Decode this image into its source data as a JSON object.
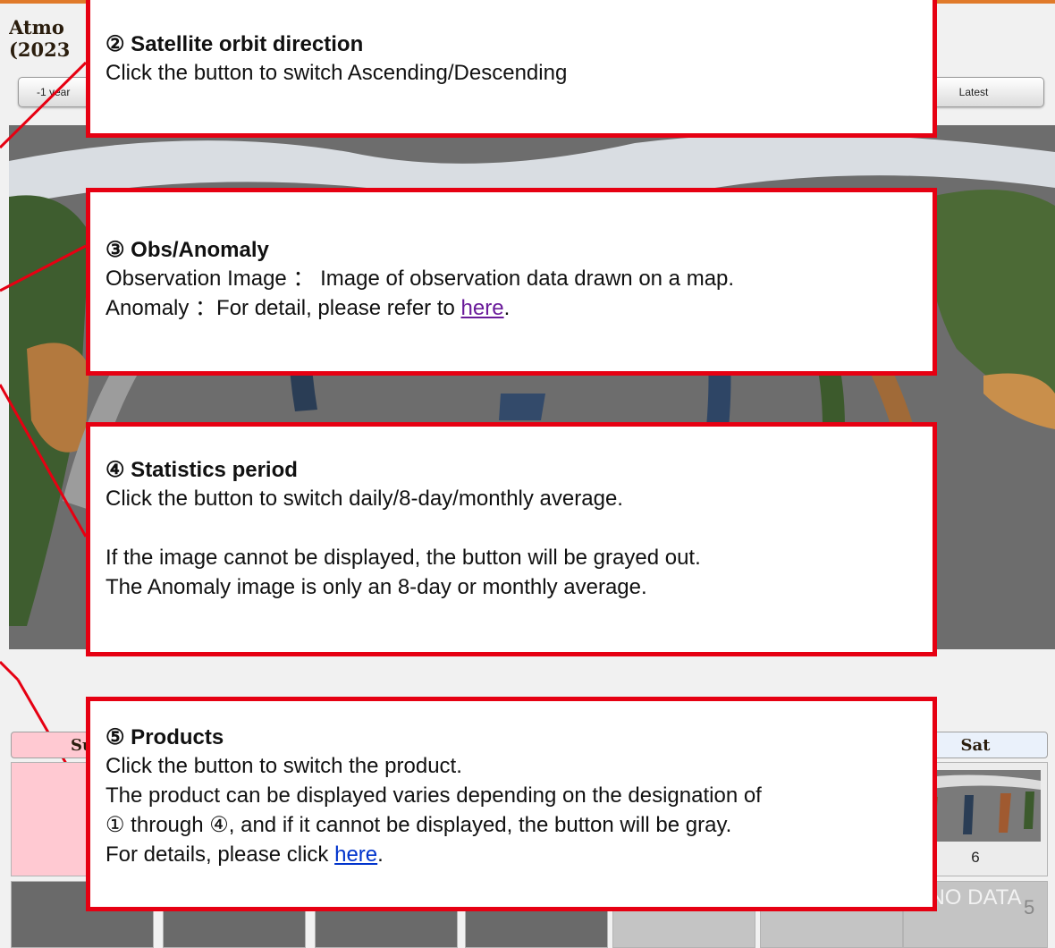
{
  "page": {
    "title_line1": "Atmo",
    "title_line2": "(2023"
  },
  "controls": {
    "prev_year_label": "-1 year",
    "latest_label": "Latest"
  },
  "callouts": {
    "orbit": {
      "heading": "② Satellite orbit direction",
      "body": "Click the button to switch Ascending/Descending"
    },
    "obs_anomaly": {
      "heading": "③ Obs/Anomaly",
      "line1": "Observation Image ： Image of observation data drawn on a map.",
      "line2_prefix": "Anomaly ：For detail, please refer to ",
      "line2_link": "here",
      "line2_suffix": "."
    },
    "statistics": {
      "heading": "④ Statistics period",
      "line1": "Click the button to switch daily/8-day/monthly average.",
      "line2": "If the image cannot be displayed, the button will be grayed out.",
      "line3": "The Anomaly image is only an 8-day or monthly average."
    },
    "products": {
      "heading": "⑤ Products",
      "line1": "Click the button to switch the product.",
      "line2": "The product can be displayed varies depending on the designation of",
      "line3": "① through ④, and if it cannot be displayed, the button will be gray.",
      "line4_prefix": "For details, please click ",
      "line4_link": "here",
      "line4_suffix": "."
    }
  },
  "calendar": {
    "sun_header": "Su",
    "sat_header": "Sat",
    "sat_day": "6",
    "no_data_label": "NO DATA"
  },
  "slide_number": "5",
  "colors": {
    "callout_border": "#e60012",
    "sun_bg": "#ffc9d2",
    "visited_link": "#6a1b9a",
    "link": "#0033cc"
  }
}
